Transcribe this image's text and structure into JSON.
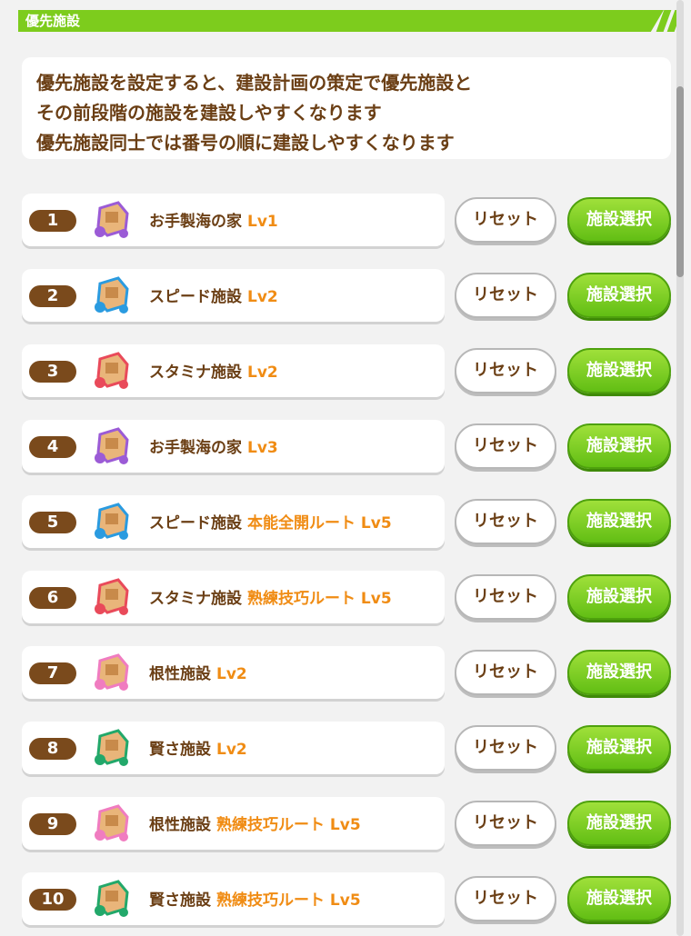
{
  "header": {
    "title": "優先施設"
  },
  "description": {
    "lines": [
      "優先施設を設定すると、建設計画の策定で優先施設と",
      "その前段階の施設を建設しやすくなります",
      "優先施設同士では番号の順に建設しやすくなります"
    ]
  },
  "buttons": {
    "reset_label": "リセット",
    "select_label": "施設選択"
  },
  "facilities": [
    {
      "number": "1",
      "name": "お手製海の家",
      "level": "Lv1",
      "icon": "beach-house-icon",
      "color": "#9b5bd6"
    },
    {
      "number": "2",
      "name": "スピード施設",
      "level": "Lv2",
      "icon": "speed-facility-icon",
      "color": "#2a9be0"
    },
    {
      "number": "3",
      "name": "スタミナ施設",
      "level": "Lv2",
      "icon": "stamina-facility-icon",
      "color": "#e94a5a"
    },
    {
      "number": "4",
      "name": "お手製海の家",
      "level": "Lv3",
      "icon": "beach-house-icon",
      "color": "#9b5bd6"
    },
    {
      "number": "5",
      "name": "スピード施設",
      "level": "本能全開ルート Lv5",
      "icon": "speed-facility-icon",
      "color": "#2a9be0"
    },
    {
      "number": "6",
      "name": "スタミナ施設",
      "level": "熟練技巧ルート Lv5",
      "icon": "stamina-facility-icon",
      "color": "#e94a5a"
    },
    {
      "number": "7",
      "name": "根性施設",
      "level": "Lv2",
      "icon": "guts-facility-icon",
      "color": "#f07cc0"
    },
    {
      "number": "8",
      "name": "賢さ施設",
      "level": "Lv2",
      "icon": "wisdom-facility-icon",
      "color": "#22a86a"
    },
    {
      "number": "9",
      "name": "根性施設",
      "level": "熟練技巧ルート Lv5",
      "icon": "guts-facility-icon",
      "color": "#f07cc0"
    },
    {
      "number": "10",
      "name": "賢さ施設",
      "level": "熟練技巧ルート Lv5",
      "icon": "wisdom-facility-icon",
      "color": "#22a86a"
    }
  ]
}
